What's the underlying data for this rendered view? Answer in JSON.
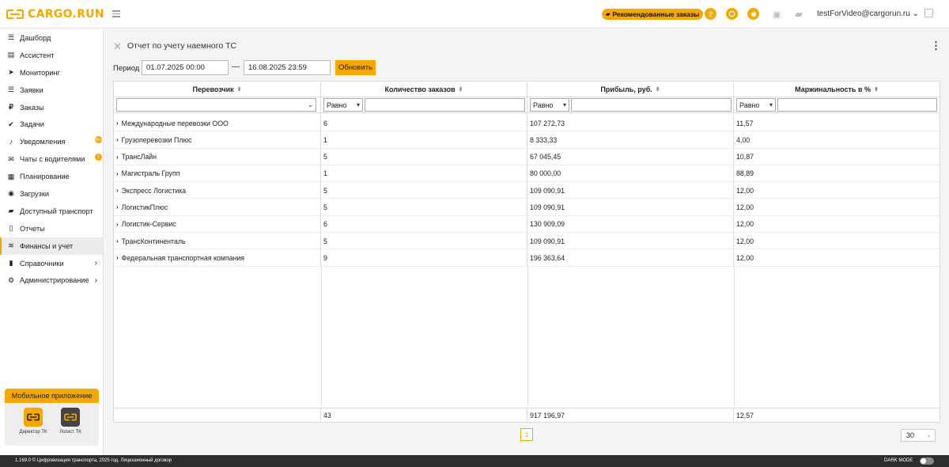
{
  "header": {
    "logo_text": "CARGO.RUN",
    "recommended_label": "Рекомендованные заказы",
    "help_glyph": "?",
    "user_email": "testForVideo@cargorun.ru",
    "user_chevron": "⌄",
    "accent_color": "#f5a800"
  },
  "sidebar": {
    "items": [
      {
        "label": "Дашборд",
        "icon": "dashboard-icon",
        "glyph": "☰"
      },
      {
        "label": "Ассистент",
        "icon": "chart-icon",
        "glyph": "▤"
      },
      {
        "label": "Мониторинг",
        "icon": "location-icon",
        "glyph": "➤"
      },
      {
        "label": "Заявки",
        "icon": "list-icon",
        "glyph": "☰"
      },
      {
        "label": "Заказы",
        "icon": "ruble-icon",
        "glyph": "₽"
      },
      {
        "label": "Задачи",
        "icon": "check-icon",
        "glyph": "✔"
      },
      {
        "label": "Уведомления",
        "icon": "bell-icon",
        "glyph": "♪"
      },
      {
        "label": "Чаты с водителями",
        "icon": "chat-icon",
        "glyph": "✉"
      },
      {
        "label": "Планирование",
        "icon": "calendar-icon",
        "glyph": "▦"
      },
      {
        "label": "Загрузки",
        "icon": "upload-icon",
        "glyph": "◉"
      },
      {
        "label": "Доступный транспорт",
        "icon": "truck-icon",
        "glyph": "▰"
      },
      {
        "label": "Отчеты",
        "icon": "report-icon",
        "glyph": "▯"
      },
      {
        "label": "Финансы и учет",
        "icon": "finance-icon",
        "glyph": "≋"
      },
      {
        "label": "Справочники",
        "icon": "book-icon",
        "glyph": "▮"
      },
      {
        "label": "Администрирование",
        "icon": "gear-icon",
        "glyph": "⚙"
      }
    ],
    "badges": {
      "notifications": "99+",
      "chats": "1"
    },
    "mobile": {
      "title": "Мобильное приложение",
      "apps": [
        {
          "label": "Директор ТК",
          "icon": "director-app-icon"
        },
        {
          "label": "Логист ТК",
          "icon": "logist-app-icon"
        }
      ]
    }
  },
  "page": {
    "title": "Отчет по учету наемного ТС",
    "period_label": "Период",
    "date_from": "01.07.2025 00:00",
    "date_separator": "—",
    "date_to": "16.08.2025 23:59",
    "refresh_label": "Обновить"
  },
  "table": {
    "columns": [
      "Перевозчик",
      "Количество заказов",
      "Прибыль, руб.",
      "Маржинальность в %"
    ],
    "filter_op": "Равно",
    "rows": [
      {
        "carrier": "Международные перевозки ООО",
        "orders": "6",
        "profit": "107 272,73",
        "margin": "11,57"
      },
      {
        "carrier": "Грузоперевозки Плюс",
        "orders": "1",
        "profit": "8 333,33",
        "margin": "4,00"
      },
      {
        "carrier": "ТрансЛайн",
        "orders": "5",
        "profit": "67 045,45",
        "margin": "10,87"
      },
      {
        "carrier": "Магистраль Групп",
        "orders": "1",
        "profit": "80 000,00",
        "margin": "88,89"
      },
      {
        "carrier": "Экспресс Логистика",
        "orders": "5",
        "profit": "109 090,91",
        "margin": "12,00"
      },
      {
        "carrier": "ЛогистикПлюс",
        "orders": "5",
        "profit": "109 090,91",
        "margin": "12,00"
      },
      {
        "carrier": "Логистик-Сервис",
        "orders": "6",
        "profit": "130 909,09",
        "margin": "12,00"
      },
      {
        "carrier": "ТрансКонтиненталь",
        "orders": "5",
        "profit": "109 090,91",
        "margin": "12,00"
      },
      {
        "carrier": "Федеральная транспортная компания",
        "orders": "9",
        "profit": "196 363,64",
        "margin": "12,00"
      }
    ],
    "totals": {
      "orders": "43",
      "profit": "917 196,97",
      "margin": "12,57"
    }
  },
  "pagination": {
    "current_page": "1",
    "page_size": "30"
  },
  "footer": {
    "text": "1.169.0 © Цифровизация транспорта, 2025 год.  Лицензионный договор",
    "dark_mode_label": "DARK MODE"
  }
}
